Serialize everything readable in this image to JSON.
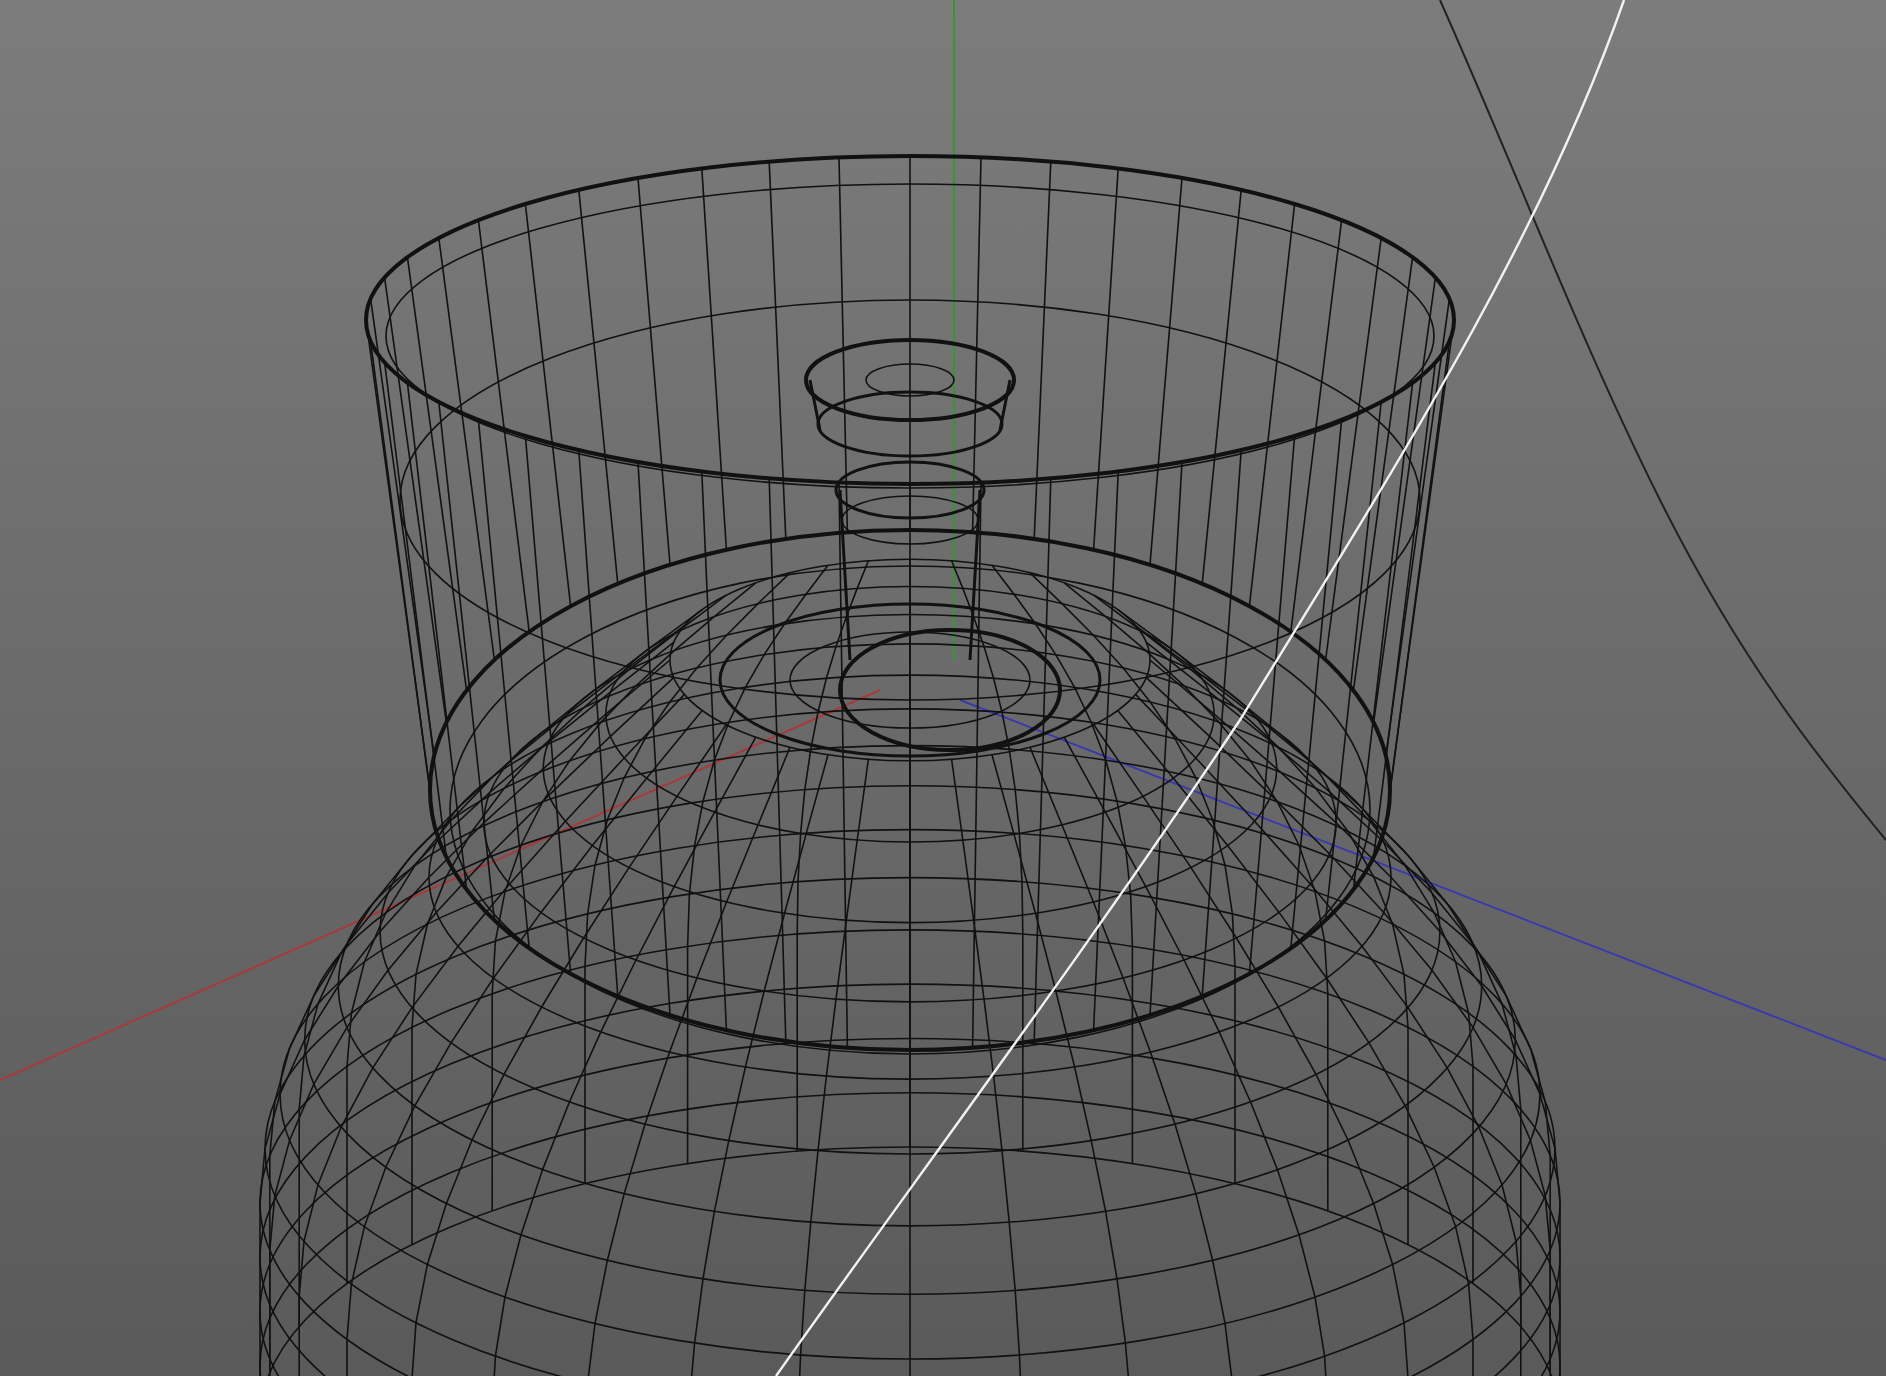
{
  "viewport": {
    "wireframe": true
  }
}
